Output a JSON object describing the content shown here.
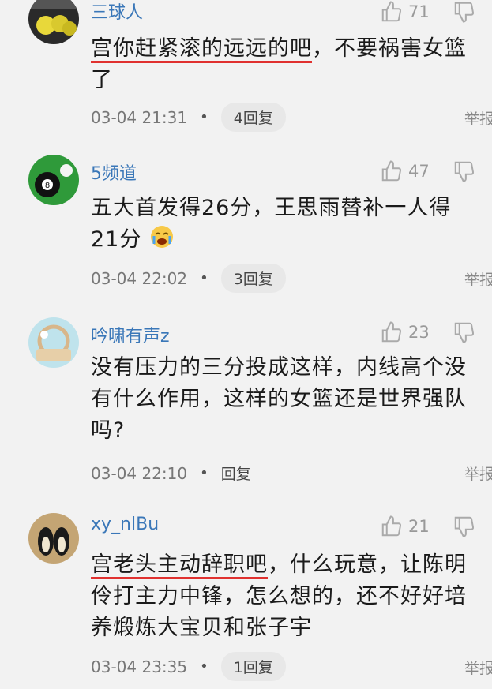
{
  "comments": [
    {
      "username": "三球人",
      "likes": "71",
      "text_marked": "宫你赶紧滚的远远的吧",
      "text_rest": "，不要祸害女篮了",
      "time": "03-04 21:31",
      "reply": "4回复",
      "report": "举报"
    },
    {
      "username": "5频道",
      "likes": "47",
      "text": "五大首发得26分，王思雨替补一人得21分",
      "time": "03-04 22:02",
      "reply": "3回复",
      "report": "举报"
    },
    {
      "username": "吟啸有声z",
      "likes": "23",
      "text": "没有压力的三分投成这样，内线高个没有什么作用，这样的女篮还是世界强队吗?",
      "time": "03-04 22:10",
      "reply": "回复",
      "report": "举报"
    },
    {
      "username": "xy_nlBu",
      "likes": "21",
      "text_marked": "宫老头主动辞职吧",
      "text_rest": "，什么玩意，让陈明伶打主力中锋，怎么想的，还不好好培养煅炼大宝贝和张子宇",
      "time": "03-04 23:35",
      "reply": "1回复",
      "report": "举报"
    }
  ],
  "separator": "•",
  "icons": [
    "thumbs-up-icon",
    "thumbs-down-icon",
    "crying-emoji-icon"
  ],
  "colors": {
    "username": "#3a77b8",
    "underline": "#e0312f",
    "background": "#f2f2f2"
  }
}
